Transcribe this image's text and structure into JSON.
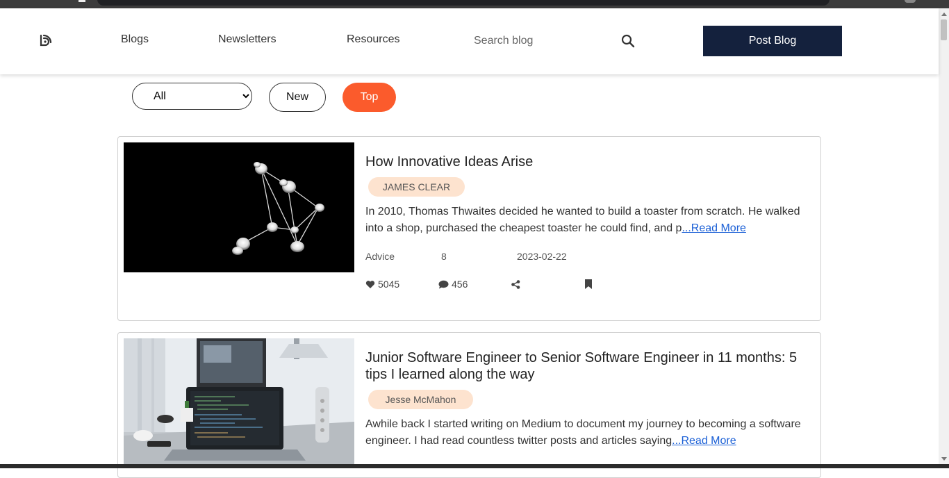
{
  "nav": {
    "links": [
      "Blogs",
      "Newsletters",
      "Resources"
    ],
    "search_placeholder": "Search blog",
    "post_button": "Post Blog"
  },
  "filters": {
    "select_value": "All",
    "new_label": "New",
    "top_label": "Top",
    "active_color": "#fb5b2c"
  },
  "posts": [
    {
      "title": "How Innovative Ideas Arise",
      "author": "JAMES CLEAR",
      "excerpt": "In 2010, Thomas Thwaites decided he wanted to build a toaster from scratch. He walked into a shop, purchased the cheapest toaster he could find, and p",
      "read_more": "...Read More",
      "category": "Advice",
      "count": "8",
      "date": "2023-02-22",
      "likes": "5045",
      "comments": "456"
    },
    {
      "title": "Junior Software Engineer to Senior Software Engineer in 11 months: 5 tips I learned along the way",
      "author": "Jesse McMahon",
      "excerpt": "Awhile back I started writing on Medium to document my journey to becoming a software engineer. I had read countless twitter posts and articles saying",
      "read_more": "...Read More"
    }
  ],
  "colors": {
    "post_button_bg": "#14213d",
    "author_badge_bg": "#fde3cf",
    "link": "#1a5fd6"
  }
}
